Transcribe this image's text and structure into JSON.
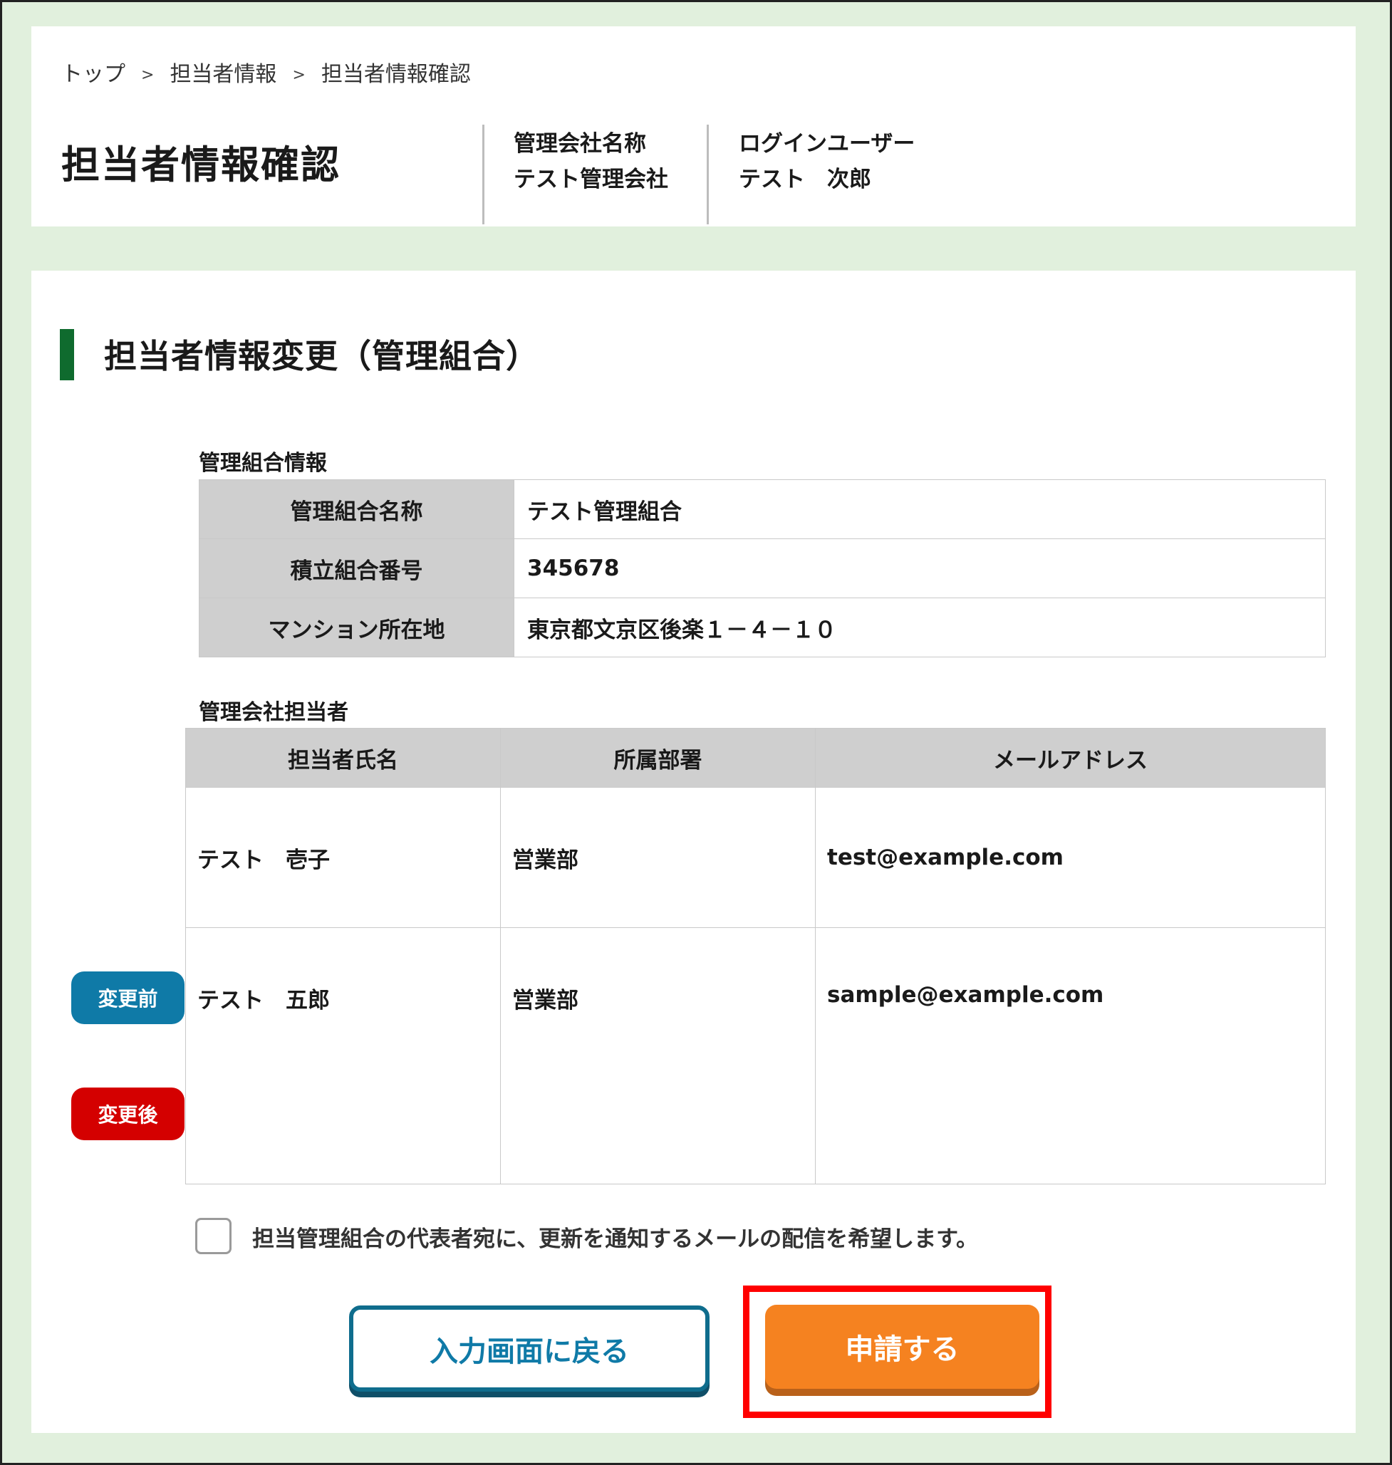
{
  "breadcrumb": {
    "items": [
      "トップ",
      "担当者情報",
      "担当者情報確認"
    ],
    "separator": ">"
  },
  "header": {
    "title": "担当者情報確認",
    "company_label": "管理会社名称",
    "company_value": "テスト管理会社",
    "user_label": "ログインユーザー",
    "user_value": "テスト　次郎"
  },
  "section": {
    "title": "担当者情報変更（管理組合）",
    "accent_color": "#0f6b2e"
  },
  "union_info": {
    "label": "管理組合情報",
    "rows": [
      {
        "key": "管理組合名称",
        "value": "テスト管理組合"
      },
      {
        "key": "積立組合番号",
        "value": "345678"
      },
      {
        "key": "マンション所在地",
        "value": "東京都文京区後楽１－４－１０"
      }
    ]
  },
  "staff": {
    "label": "管理会社担当者",
    "columns": [
      "担当者氏名",
      "所属部署",
      "メールアドレス"
    ],
    "rows": [
      {
        "name": "テスト　壱子",
        "dept": "営業部",
        "email": "test@example.com"
      },
      {
        "name": "テスト　五郎",
        "dept": "営業部",
        "email": "sample@example.com"
      }
    ],
    "badge_before": "変更前",
    "badge_after": "変更後",
    "badge_before_color": "#0f7aa7",
    "badge_after_color": "#d40000"
  },
  "notify": {
    "label": "担当管理組合の代表者宛に、更新を通知するメールの配信を希望します。",
    "checked": false
  },
  "buttons": {
    "back_label": "入力画面に戻る",
    "submit_label": "申請する",
    "submit_color": "#f58220",
    "highlight_color": "#ff0000"
  }
}
